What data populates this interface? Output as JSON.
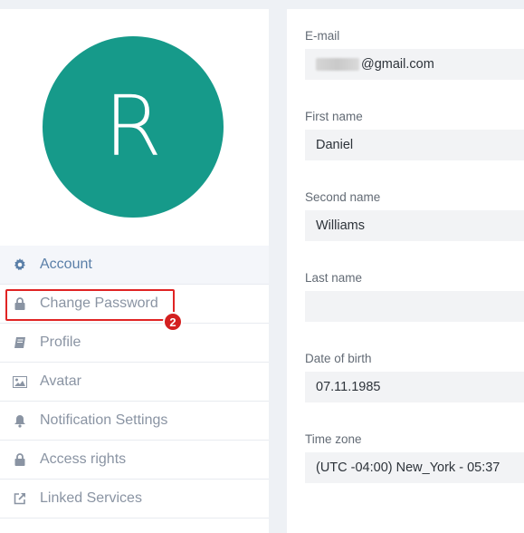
{
  "avatar": {
    "initial": "R",
    "color": "#169a8a"
  },
  "menu": {
    "items": [
      {
        "label": "Account",
        "icon": "gear-icon",
        "active": true
      },
      {
        "label": "Change Password",
        "icon": "lock-icon",
        "active": false
      },
      {
        "label": "Profile",
        "icon": "book-icon",
        "active": false
      },
      {
        "label": "Avatar",
        "icon": "image-icon",
        "active": false
      },
      {
        "label": "Notification Settings",
        "icon": "bell-icon",
        "active": false
      },
      {
        "label": "Access rights",
        "icon": "lock-icon",
        "active": false
      },
      {
        "label": "Linked Services",
        "icon": "external-link-icon",
        "active": false
      }
    ],
    "highlight_badge": "2"
  },
  "form": {
    "email": {
      "label": "E-mail",
      "value": "@gmail.com"
    },
    "first_name": {
      "label": "First name",
      "value": "Daniel"
    },
    "second_name": {
      "label": "Second name",
      "value": "Williams"
    },
    "last_name": {
      "label": "Last name",
      "value": ""
    },
    "date_of_birth": {
      "label": "Date of birth",
      "value": "07.11.1985"
    },
    "time_zone": {
      "label": "Time zone",
      "value": "(UTC -04:00) New_York - 05:37"
    }
  },
  "colors": {
    "accent": "#5a7fa8",
    "highlight": "#e02424",
    "muted": "#8a94a3"
  }
}
